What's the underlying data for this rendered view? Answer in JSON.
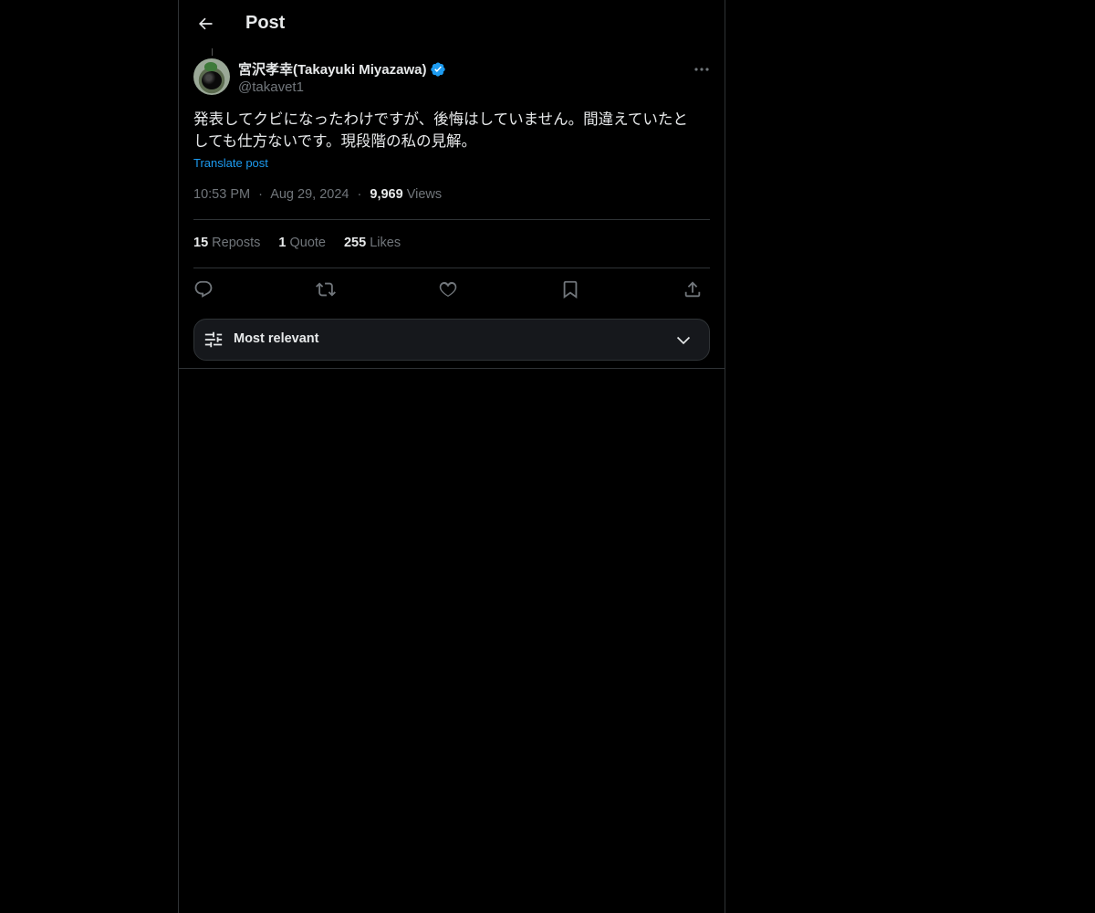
{
  "header": {
    "title": "Post",
    "back_icon": "arrow-left-icon"
  },
  "post": {
    "author": {
      "display_name": "宮沢孝幸(Takayuki Miyazawa)",
      "handle": "@takavet1",
      "verified": true,
      "verified_color": "#1d9bf0"
    },
    "text_line1": "発表してクビになったわけですが、後悔はしていません。間違えていたと",
    "text_line2": "しても仕方ないです。現段階の私の見解。",
    "translate_label": "Translate post",
    "time": "10:53 PM",
    "date": "Aug 29, 2024",
    "separator": "·",
    "views_count": "9,969",
    "views_label": "Views"
  },
  "stats": {
    "reposts_count": "15",
    "reposts_label": "Reposts",
    "quotes_count": "1",
    "quotes_label": "Quote",
    "likes_count": "255",
    "likes_label": "Likes"
  },
  "actions": [
    "reply-icon",
    "repost-icon",
    "like-icon",
    "bookmark-icon",
    "share-icon"
  ],
  "sort": {
    "label": "Most relevant",
    "icon": "sliders-icon",
    "chevron": "chevron-down-icon"
  },
  "colors": {
    "background": "#000000",
    "text": "#e7e9ea",
    "secondary": "#71767b",
    "accent": "#1d9bf0",
    "border": "#2f3336"
  }
}
